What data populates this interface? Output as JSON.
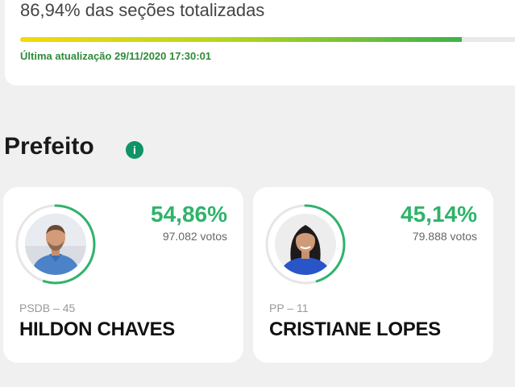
{
  "status": {
    "progress_text": "86,94% das seções totalizadas",
    "progress_value": 0.8694,
    "last_update": "Última atualização 29/11/2020 17:30:01"
  },
  "section": {
    "title": "Prefeito",
    "info_icon": "i"
  },
  "candidates": [
    {
      "percent": "54,86%",
      "percent_value": 0.5486,
      "votes": "97.082 votos",
      "party": "PSDB – 45",
      "name": "HILDON CHAVES",
      "photo_icon": "male-candidate-photo"
    },
    {
      "percent": "45,14%",
      "percent_value": 0.4514,
      "votes": "79.888 votos",
      "party": "PP – 11",
      "name": "CRISTIANE LOPES",
      "photo_icon": "female-candidate-photo"
    }
  ],
  "colors": {
    "accent_green": "#2fb36b",
    "update_green": "#2e8b3a",
    "ring_track": "#e6e6e6"
  }
}
